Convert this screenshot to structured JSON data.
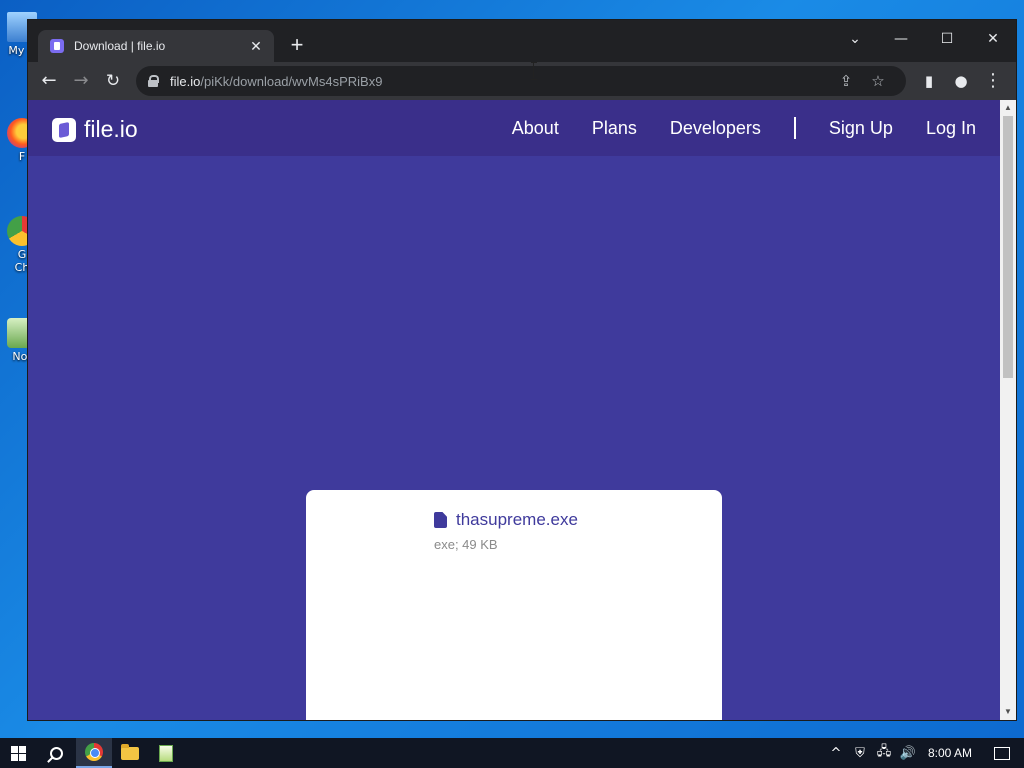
{
  "desktop": {
    "icons": [
      {
        "label": "My C"
      },
      {
        "label": "F"
      },
      {
        "label": "G\nCh"
      },
      {
        "label": "Not"
      }
    ]
  },
  "browser": {
    "tab": {
      "title": "Download | file.io",
      "close": "✕"
    },
    "new_tab": "+",
    "window_controls": {
      "tab_search": "⌄",
      "minimize": "—",
      "maximize": "☐",
      "close": "✕"
    },
    "toolbar": {
      "back": "←",
      "forward": "→",
      "reload": "↻",
      "share": "⇪",
      "bookmark": "☆",
      "side_panel": "▮",
      "profile": "●",
      "menu": "⋮"
    },
    "address": {
      "host": "file.io",
      "path": "/piKk/download/wvMs4sPRiBx9"
    }
  },
  "site": {
    "logo": "file.io",
    "nav": [
      "About",
      "Plans",
      "Developers",
      "Sign Up",
      "Log In"
    ],
    "file": {
      "name": "thasupreme.exe",
      "meta": "exe; 49 KB"
    }
  },
  "scrollbar": {
    "up": "▲",
    "down": "▼"
  },
  "taskbar": {
    "tray": {
      "chevron": "^",
      "security": "⛨",
      "network": "🖧",
      "volume": "🔊",
      "time": "8:00 AM"
    }
  },
  "colors": {
    "site_bg": "#3f3a9c",
    "header_bg": "#3a2f8a",
    "accent": "#3f3a9c"
  }
}
